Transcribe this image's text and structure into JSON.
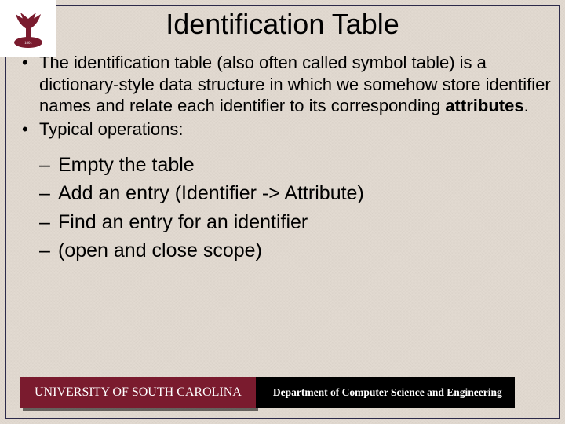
{
  "title": "Identification Table",
  "bullets": [
    {
      "pre": "The identification table (also often called symbol table) is a dictionary-style data structure in which we somehow store identifier names and relate each identifier to its corresponding ",
      "bold": "attributes",
      "post": "."
    },
    {
      "pre": "Typical operations:",
      "bold": "",
      "post": ""
    }
  ],
  "subitems": [
    "Empty the table",
    "Add an entry (Identifier -> Attribute)",
    "Find an entry for an identifier",
    "(open and close scope)"
  ],
  "footer": {
    "university": "UNIVERSITY OF SOUTH CAROLINA",
    "department": "Department of Computer Science and Engineering"
  }
}
